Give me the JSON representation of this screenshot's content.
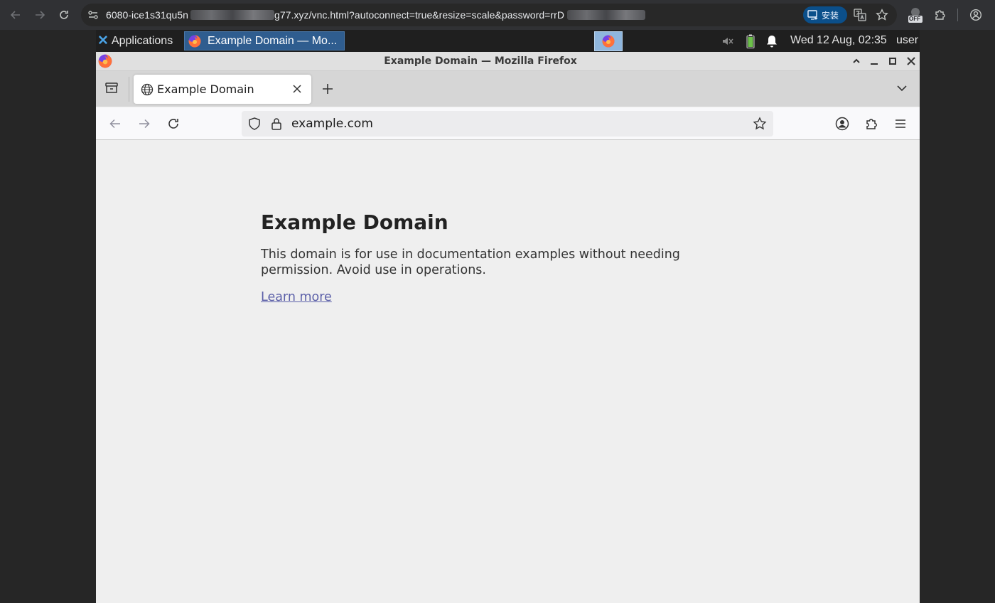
{
  "chrome": {
    "url_start": "6080-ice1s31qu5n",
    "url_end": "g77.xyz/vnc.html?autoconnect=true&resize=scale&password=rrD",
    "install_label": "安装",
    "extension_badge": "OFF"
  },
  "panel": {
    "applications_label": "Applications",
    "task_title": "Example Domain — Mo...",
    "clock": "Wed 12 Aug, 02:35",
    "user": "user"
  },
  "firefox": {
    "window_title": "Example Domain — Mozilla Firefox",
    "tab_title": "Example Domain",
    "url": "example.com"
  },
  "page": {
    "heading": "Example Domain",
    "paragraph": "This domain is for use in documentation examples without needing permission. Avoid use in operations.",
    "link_text": "Learn more"
  },
  "colors": {
    "chrome_bg": "#303134",
    "panel_bg": "#1f1f1f",
    "active_task": "#2f5d8f",
    "page_bg": "#efefef",
    "link": "#5b5fa8"
  },
  "icons": [
    "back-icon",
    "forward-icon",
    "reload-icon",
    "site-info-icon",
    "translate-icon",
    "bookmark-star-icon",
    "extensions-icon",
    "profile-icon",
    "firefox-icon",
    "mute-icon",
    "battery-icon",
    "bell-icon",
    "globe-icon",
    "close-icon",
    "plus-icon",
    "chevron-down-icon",
    "shield-icon",
    "lock-icon",
    "account-icon",
    "menu-icon"
  ]
}
